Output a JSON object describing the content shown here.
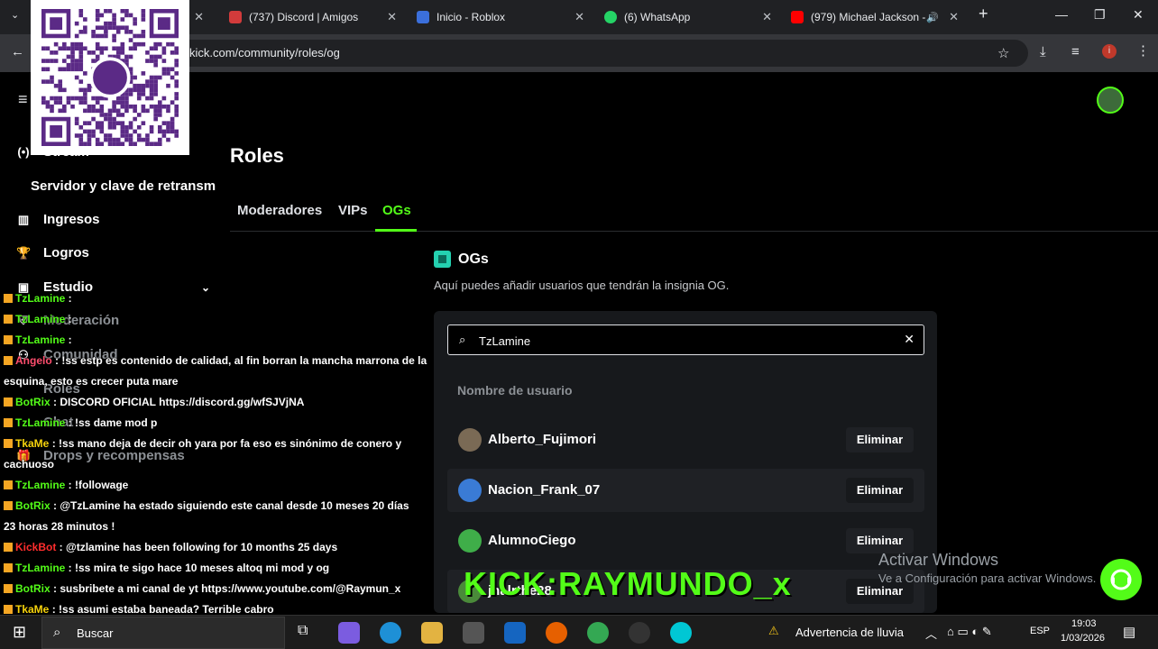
{
  "browser": {
    "tabs": [
      {
        "title": "(737) Discord | Amigos",
        "color": "#5865f2"
      },
      {
        "title": "Inicio - Roblox",
        "color": "#3b6fdb"
      },
      {
        "title": "(6) WhatsApp",
        "color": "#25d366"
      },
      {
        "title": "(979) Michael Jackson -",
        "color": "#ff0000"
      }
    ],
    "url": "kick.com/community/roles/og"
  },
  "sidebar": {
    "stream_label": "Stream",
    "server_label": "Servidor y clave de retransm",
    "items": [
      {
        "label": "Ingresos",
        "icon": "bar-chart-icon"
      },
      {
        "label": "Logros",
        "icon": "trophy-icon"
      },
      {
        "label": "Estudio",
        "icon": "studio-icon"
      },
      {
        "label": "Moderación",
        "icon": "shield-icon"
      },
      {
        "label": "Comunidad",
        "icon": "community-icon"
      },
      {
        "label": "Roles",
        "icon": ""
      },
      {
        "label": "Chat",
        "icon": ""
      },
      {
        "label": "Drops y recompensas",
        "icon": "gift-icon"
      }
    ]
  },
  "main": {
    "title": "Roles",
    "tabs": [
      "Moderadores",
      "VIPs",
      "OGs"
    ],
    "active_tab": "OGs",
    "section_title": "OGs",
    "section_description": "Aquí puedes añadir usuarios que tendrán la insignia OG.",
    "search": {
      "value": "TzLamine",
      "placeholder": ""
    },
    "column_header": "Nombre de usuario",
    "remove_label": "Eliminar",
    "users": [
      {
        "name": "Alberto_Fujimori",
        "avatar_color": "#7a6a55"
      },
      {
        "name": "Nacion_Frank_07",
        "avatar_color": "#3a7bd5"
      },
      {
        "name": "AlumnoCiego",
        "avatar_color": "#3fae49"
      },
      {
        "name": "jnalrthe28",
        "avatar_color": "#4a8a3a"
      }
    ]
  },
  "chat": [
    {
      "user": "TzLamine",
      "msg": "",
      "color": "#53fc18"
    },
    {
      "user": "TzLamine",
      "msg": "",
      "color": "#53fc18"
    },
    {
      "user": "TzLamine",
      "msg": "",
      "color": "#53fc18"
    },
    {
      "user": "Angelo",
      "msg": "!ss estp es contenido de calidad, al fin borran la mancha marrona de la",
      "color": "#ff4d6d"
    },
    {
      "user": "",
      "msg": "esquina, esto es crecer puta mare",
      "color": "#ffffff"
    },
    {
      "user": "BotRix",
      "msg": "DISCORD OFICIAL https://discord.gg/wfSJVjNA",
      "color": "#53fc18"
    },
    {
      "user": "TzLamine",
      "msg": "!ss dame mod p",
      "color": "#53fc18"
    },
    {
      "user": "TkaMe",
      "msg": "!ss mano deja de decir oh yara por fa eso es sinónimo de conero y",
      "color": "#f5d20c"
    },
    {
      "user": "",
      "msg": "cachuoso",
      "color": "#ffffff"
    },
    {
      "user": "TzLamine",
      "msg": "!followage",
      "color": "#53fc18"
    },
    {
      "user": "BotRix",
      "msg": "@TzLamine ha estado siguiendo este canal desde 10 meses 20 días",
      "color": "#53fc18"
    },
    {
      "user": "",
      "msg": "23 horas 28 minutos !",
      "color": "#ffffff"
    },
    {
      "user": "KickBot",
      "msg": "@tzlamine has been following for 10 months 25 days",
      "color": "#ff2d2d"
    },
    {
      "user": "TzLamine",
      "msg": "!ss mira te sigo hace 10 meses altoq mi mod y og",
      "color": "#53fc18"
    },
    {
      "user": "BotRix",
      "msg": "susbribete a mi canal de yt https://www.youtube.com/@Raymun_x",
      "color": "#53fc18"
    },
    {
      "user": "TkaMe",
      "msg": "!ss asumi estaba baneada? Terrible cabro",
      "color": "#f5d20c"
    }
  ],
  "overlay": {
    "brand": "KICK:RAYMUNDO_x",
    "activate_title": "Activar Windows",
    "activate_sub": "Ve a Configuración para activar Windows."
  },
  "taskbar": {
    "search_label": "Buscar",
    "weather": "Advertencia de lluvia",
    "lang": "ESP",
    "time": "19:03",
    "date": "1/03/2026"
  }
}
